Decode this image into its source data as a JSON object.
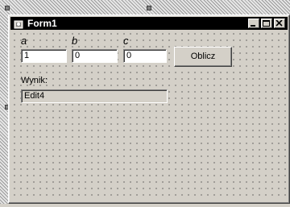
{
  "window": {
    "title": "Form1",
    "icon": "delphi-form-icon"
  },
  "labels": {
    "a": "a",
    "b": "b",
    "c": "c",
    "result": "Wynik:"
  },
  "inputs": {
    "a_value": "1",
    "b_value": "0",
    "c_value": "0",
    "result_value": "Edit4"
  },
  "buttons": {
    "compute": "Oblicz"
  },
  "colors": {
    "face": "#d4d0c8",
    "titlebar": "#000000",
    "title_text": "#ffffff"
  }
}
